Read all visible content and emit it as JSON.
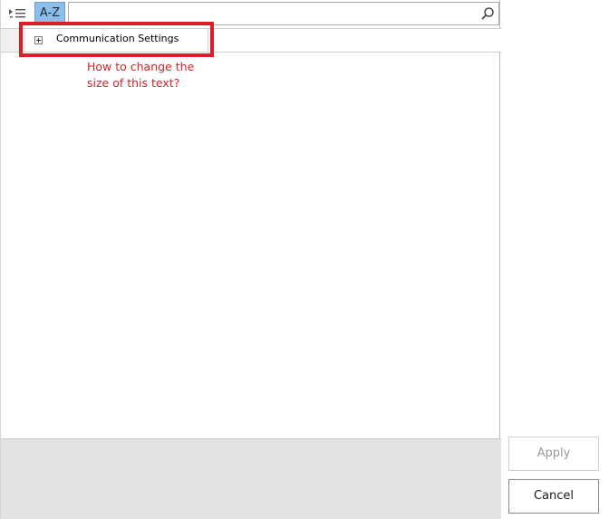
{
  "toolbar": {
    "categorized_icon": "categorized-list-icon",
    "az_label": "A-Z",
    "search_value": "",
    "search_placeholder": "",
    "search_icon": "magnifier-icon"
  },
  "grid": {
    "rows": [
      {
        "expand_icon": "plus-square-icon",
        "label": "Communication Settings"
      }
    ]
  },
  "annotation": {
    "line1": "How to change the",
    "line2": "size of this text?"
  },
  "buttons": {
    "apply_label": "Apply",
    "cancel_label": "Cancel"
  },
  "colors": {
    "highlight": "#d9202a",
    "az_active": "#8dbde9",
    "description_bg": "#e3e3e3"
  }
}
